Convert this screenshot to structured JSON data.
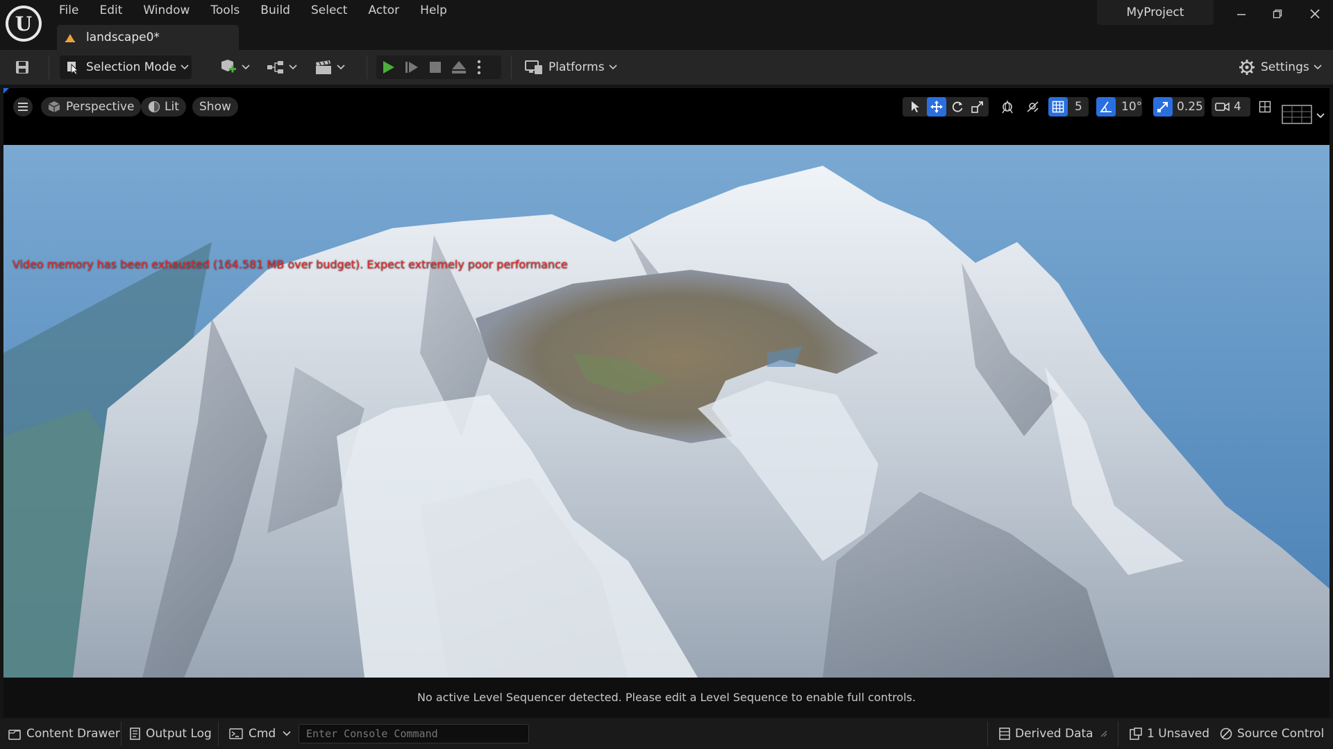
{
  "app": {
    "project_name": "MyProject",
    "logo_letter": "U"
  },
  "menu": [
    "File",
    "Edit",
    "Window",
    "Tools",
    "Build",
    "Select",
    "Actor",
    "Help"
  ],
  "tab": {
    "label": "landscape0*"
  },
  "toolbar": {
    "mode_label": "Selection Mode",
    "platforms_label": "Platforms",
    "settings_label": "Settings"
  },
  "viewport": {
    "perspective_label": "Perspective",
    "lit_label": "Lit",
    "show_label": "Show",
    "grid_snap_value": "5",
    "rotation_snap_value": "10°",
    "scale_snap_value": "0.25",
    "camera_speed_value": "4",
    "warning_text": "Video memory has been exhausted (164.581 MB over budget). Expect extremely poor performance"
  },
  "sequencer": {
    "message": "No active Level Sequencer detected. Please edit a Level Sequence to enable full controls."
  },
  "statusbar": {
    "content_drawer": "Content Drawer",
    "output_log": "Output Log",
    "cmd_label": "Cmd",
    "console_placeholder": "Enter Console Command",
    "derived_data": "Derived Data",
    "unsaved": "1 Unsaved",
    "source_control": "Source Control"
  },
  "colors": {
    "accent": "#2a6fe0",
    "play_green": "#4caf3a",
    "warning_red": "#e03030",
    "sky": "#6a9cc8"
  }
}
